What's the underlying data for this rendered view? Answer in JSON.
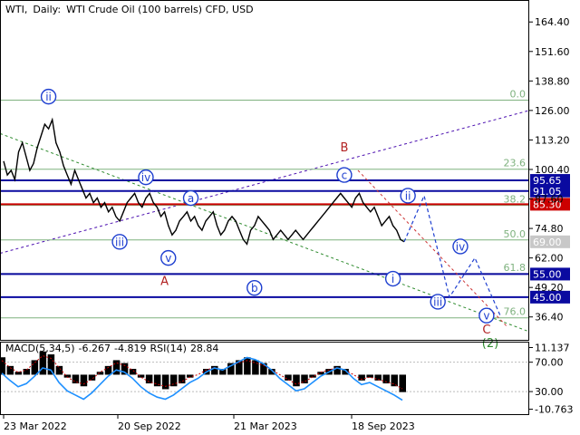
{
  "header": {
    "symbol": "WTI,",
    "timeframe": "Daily:",
    "description": "WTI Crude Oil (100 barrels) CFD, USD"
  },
  "indicator_header": {
    "macd": "MACD(5,34,5)",
    "macd_val1": "-6.267",
    "macd_val2": "-4.819",
    "rsi": "RSI(14)",
    "rsi_val": "28.84"
  },
  "colors": {
    "price_line": "#000000",
    "fib_line": "#7fb27f",
    "blue_level": "#0a0aa0",
    "red_level": "#cc0000",
    "wave_blue": "#1e3fd0",
    "wave_red": "#b22222",
    "wave_green": "#2e8b2e",
    "macd_hist": "#000000",
    "macd_signal": "#cc0000",
    "rsi_line": "#1e90ff",
    "channel_purple": "#4b0fb0",
    "channel_green": "#2e8b2e",
    "projection_blue": "#1e3fd0",
    "projection_red": "#cc3333"
  },
  "chart_data": [
    {
      "type": "line",
      "panel": "price",
      "y_ticks": [
        "164.40",
        "151.60",
        "138.80",
        "126.00",
        "113.20",
        "100.40",
        "87.60",
        "74.80",
        "62.00",
        "49.20",
        "36.40"
      ],
      "ylim": [
        30,
        170
      ],
      "x_ticks": [
        "23 Mar 2022",
        "20 Sep 2022",
        "21 Mar 2023",
        "18 Sep 2023"
      ],
      "series": [
        {
          "values": [
            104,
            98,
            100,
            96,
            108,
            112,
            106,
            100,
            103,
            110,
            115,
            120,
            118,
            122,
            112,
            108,
            102,
            98,
            94,
            100,
            96,
            92,
            88,
            90,
            86,
            88,
            84,
            86,
            82,
            84,
            80,
            78,
            82,
            86,
            88,
            90,
            86,
            84,
            88,
            90,
            86,
            84,
            80,
            82,
            76,
            72,
            74,
            78,
            80,
            82,
            78,
            80,
            76,
            74,
            78,
            80,
            82,
            76,
            72,
            74,
            78,
            80,
            78,
            74,
            70,
            68,
            74,
            76,
            80,
            78,
            76,
            74,
            70,
            72,
            74,
            72,
            70,
            72,
            74,
            72,
            70,
            72,
            74,
            76,
            78,
            80,
            82,
            84,
            86,
            88,
            90,
            88,
            86,
            84,
            88,
            90,
            86,
            84,
            82,
            84,
            80,
            76,
            78,
            80,
            76,
            74,
            70,
            69
          ]
        }
      ],
      "levels": [
        {
          "label": "95.65",
          "value": 95.65,
          "kind": "blue"
        },
        {
          "label": "91.05",
          "value": 91.05,
          "kind": "blue"
        },
        {
          "label": "85.30",
          "value": 85.3,
          "kind": "red"
        },
        {
          "label": "69.00",
          "value": 69.0,
          "kind": "plain"
        },
        {
          "label": "55.00",
          "value": 55.0,
          "kind": "blue"
        },
        {
          "label": "45.00",
          "value": 45.0,
          "kind": "blue"
        }
      ],
      "fib_levels": [
        {
          "label": "0.0",
          "value": 130.5
        },
        {
          "label": "23.6",
          "value": 100.5
        },
        {
          "label": "38.2",
          "value": 84.8
        },
        {
          "label": "50.0",
          "value": 69.8
        },
        {
          "label": "61.8",
          "value": 55.2
        },
        {
          "label": "76.0",
          "value": 36.0
        }
      ],
      "wave_labels": [
        {
          "text": "ii",
          "style": "circle",
          "color": "blue",
          "x_index": 12,
          "price": 132
        },
        {
          "text": "iv",
          "style": "circle",
          "color": "blue",
          "x_index": 38,
          "price": 97
        },
        {
          "text": "iii",
          "style": "circle",
          "color": "blue",
          "x_index": 31,
          "price": 69
        },
        {
          "text": "a",
          "style": "circle",
          "color": "blue",
          "x_index": 50,
          "price": 88
        },
        {
          "text": "v",
          "style": "circle",
          "color": "blue",
          "x_index": 44,
          "price": 62
        },
        {
          "text": "A",
          "style": "plain",
          "color": "red",
          "x_index": 43,
          "price": 52
        },
        {
          "text": "b",
          "style": "circle",
          "color": "blue",
          "x_index": 67,
          "price": 49
        },
        {
          "text": "B",
          "style": "plain",
          "color": "red",
          "x_index": 91,
          "price": 110
        },
        {
          "text": "c",
          "style": "circle",
          "color": "blue",
          "x_index": 91,
          "price": 98
        },
        {
          "text": "ii",
          "style": "circle",
          "color": "blue",
          "x_index": 108,
          "price": 89
        },
        {
          "text": "i",
          "style": "circle",
          "color": "blue",
          "x_index": 104,
          "price": 53
        },
        {
          "text": "iv",
          "style": "circle",
          "color": "blue",
          "x_index": 122,
          "price": 67
        },
        {
          "text": "iii",
          "style": "circle",
          "color": "blue",
          "x_index": 116,
          "price": 43
        },
        {
          "text": "v",
          "style": "circle",
          "color": "blue",
          "x_index": 129,
          "price": 37
        },
        {
          "text": "C",
          "style": "plain",
          "color": "red",
          "x_index": 129,
          "price": 31
        },
        {
          "text": "(2)",
          "style": "plain",
          "color": "green",
          "x_index": 130,
          "price": 25
        }
      ]
    },
    {
      "type": "line",
      "panel": "indicator",
      "y_ticks": [
        "11.137",
        "70.00",
        "30.00",
        "-10.763"
      ],
      "series": [
        {
          "name": "MACD",
          "values": [
            6,
            3,
            1,
            2,
            5,
            8,
            7,
            3,
            -1,
            -3,
            -4,
            -2,
            1,
            3,
            5,
            4,
            2,
            -1,
            -3,
            -4,
            -5,
            -4,
            -3,
            -1,
            0,
            2,
            3,
            2,
            4,
            5,
            6,
            5,
            4,
            2,
            0,
            -2,
            -4,
            -3,
            -1,
            1,
            2,
            3,
            2,
            0,
            -2,
            -1,
            -2,
            -3,
            -4,
            -6
          ]
        },
        {
          "name": "RSI",
          "values": [
            55,
            48,
            42,
            45,
            52,
            60,
            58,
            46,
            38,
            34,
            30,
            36,
            44,
            52,
            58,
            56,
            50,
            42,
            36,
            32,
            30,
            34,
            40,
            46,
            50,
            56,
            60,
            58,
            62,
            66,
            70,
            68,
            64,
            58,
            50,
            44,
            38,
            40,
            46,
            52,
            56,
            60,
            58,
            50,
            44,
            46,
            42,
            38,
            34,
            29
          ]
        }
      ]
    }
  ]
}
